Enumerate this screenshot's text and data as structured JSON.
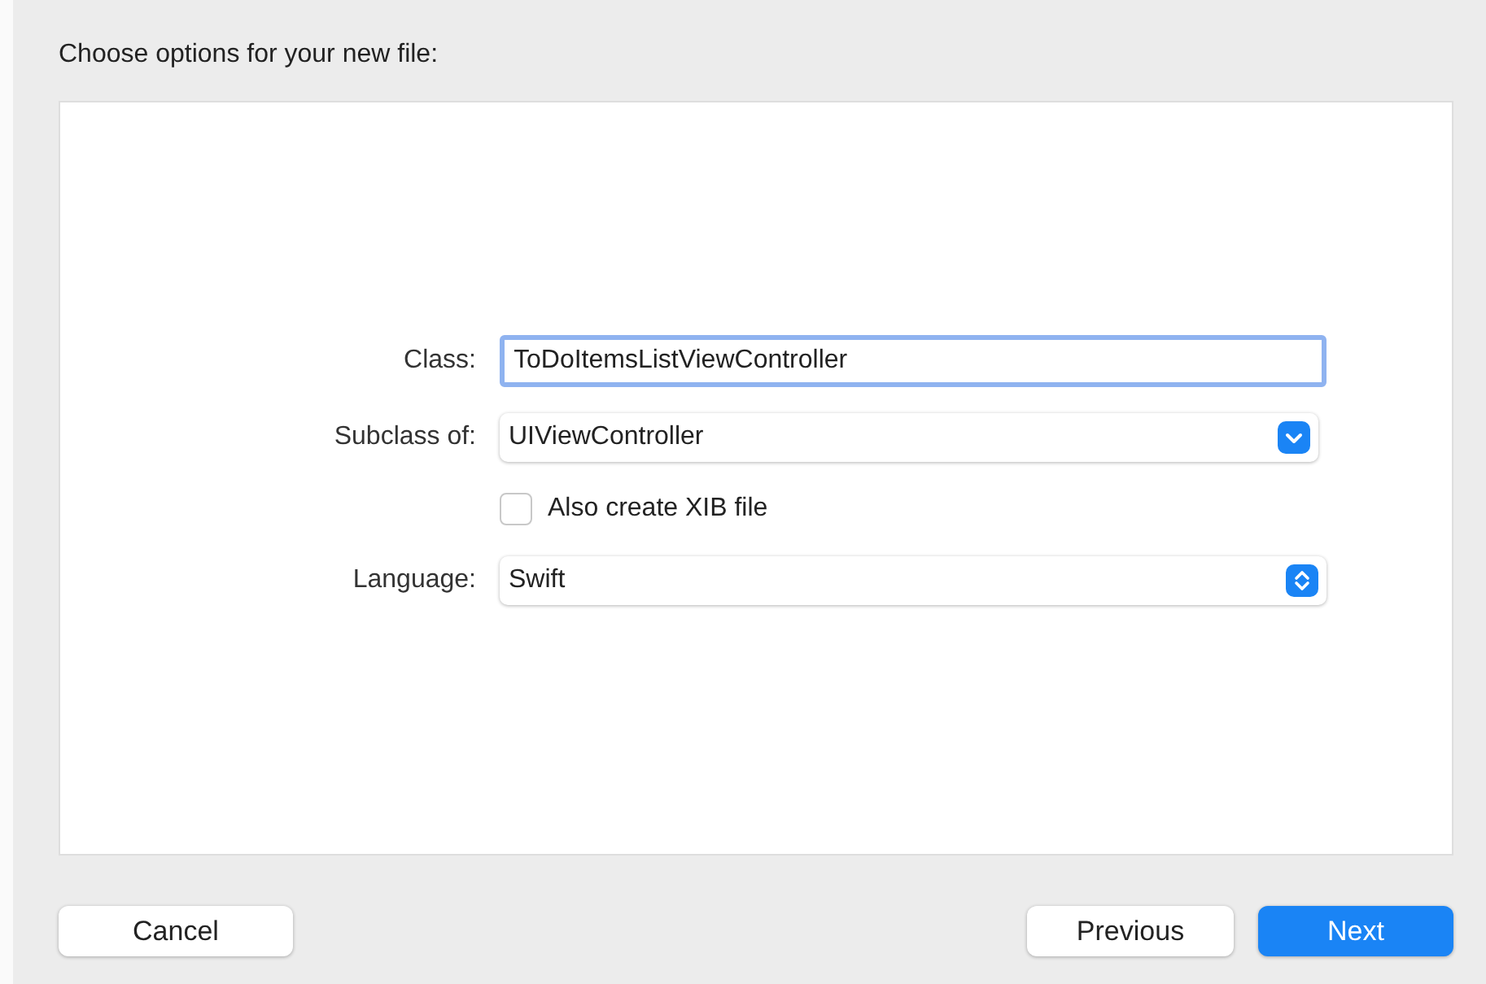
{
  "heading": "Choose options for your new file:",
  "form": [
    {
      "kind": "text",
      "label": "Class:",
      "value": "ToDoItemsListViewController"
    },
    {
      "kind": "dropdown",
      "label": "Subclass of:",
      "value": "UIViewController"
    },
    {
      "kind": "checkbox",
      "label": "Also create XIB file",
      "checked": false
    },
    {
      "kind": "popup",
      "label": "Language:",
      "value": "Swift"
    }
  ],
  "buttons": [
    {
      "label": "Cancel",
      "default": false
    },
    {
      "label": "Previous",
      "default": false
    },
    {
      "label": "Next",
      "default": true
    }
  ]
}
